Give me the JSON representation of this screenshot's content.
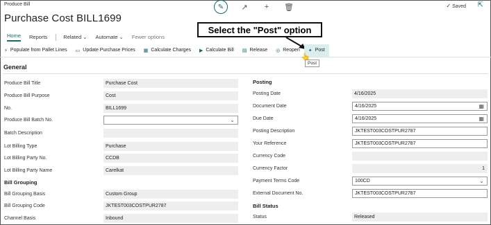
{
  "breadcrumb": "Produce Bill",
  "title": "Purchase Cost BILL1699",
  "status_saved": "Saved",
  "menu": {
    "home": "Home",
    "reports": "Reports",
    "related": "Related",
    "automate": "Automate",
    "fewer": "Fewer options"
  },
  "callout": "Select the \"Post\" option",
  "actions": [
    {
      "label": "Populate from Pallet Lines",
      "icon": "⚡"
    },
    {
      "label": "Update Purchase Prices",
      "icon": "▭"
    },
    {
      "label": "Calculate Charges",
      "icon": "▦"
    },
    {
      "label": "Calculate Bill",
      "icon": "▶"
    },
    {
      "label": "Release",
      "icon": "▤"
    },
    {
      "label": "Reopen",
      "icon": "◎"
    },
    {
      "label": "Post",
      "icon": "✦"
    }
  ],
  "tooltip": "Post",
  "section_title": "General",
  "left_fields": [
    {
      "label": "Produce Bill Title",
      "value": "Purchase Cost"
    },
    {
      "label": "Produce Bill Purpose",
      "value": "Cost"
    },
    {
      "label": "No.",
      "value": "BILL1699"
    },
    {
      "label": "Produce Bill Batch No.",
      "value": ""
    },
    {
      "label": "Batch Description",
      "value": ""
    },
    {
      "label": "Lot Billing Type",
      "value": "Purchase"
    },
    {
      "label": "Lot Billing Party No.",
      "value": "CCDB"
    },
    {
      "label": "Lot Billing Party Name",
      "value": "Carelkat"
    }
  ],
  "bill_grouping_title": "Bill Grouping",
  "grouping_fields": [
    {
      "label": "Bill Grouping Basis",
      "value": "Custom Group"
    },
    {
      "label": "Bill Grouping Code",
      "value": "JKTEST003COSTPUR2787"
    },
    {
      "label": "Channel Basis",
      "value": "Inbound"
    }
  ],
  "posting_title": "Posting",
  "right_fields": [
    {
      "label": "Posting Date",
      "value": "4/16/2025"
    },
    {
      "label": "Document Date",
      "value": "4/16/2025"
    },
    {
      "label": "Due Date",
      "value": "4/16/2025"
    },
    {
      "label": "Posting Description",
      "value": "JKTEST003COSTPUR2787"
    },
    {
      "label": "Your Reference",
      "value": "JKTEST003COSTPUR2787"
    },
    {
      "label": "Currency Code",
      "value": ""
    },
    {
      "label": "Currency Factor",
      "value": "1"
    },
    {
      "label": "Payment Terms Code",
      "value": "100CD"
    },
    {
      "label": "External Document No.",
      "value": "JKTEST003COSTPUR2787"
    }
  ],
  "bill_status_title": "Bill Status",
  "status_field": {
    "label": "Status",
    "value": "Released"
  }
}
